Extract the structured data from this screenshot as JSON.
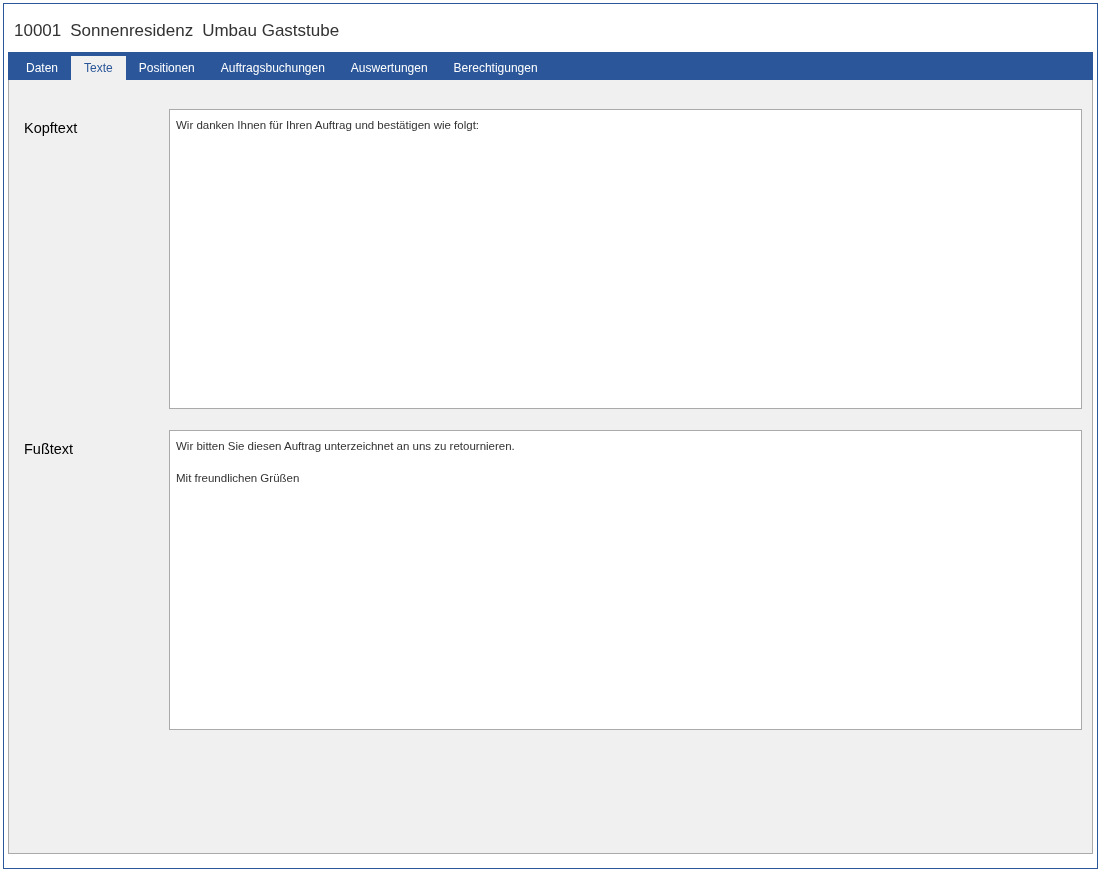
{
  "window": {
    "title_parts": [
      "10001",
      "Sonnenresidenz",
      "Umbau Gaststube"
    ]
  },
  "tabs": [
    {
      "label": "Daten",
      "selected": false
    },
    {
      "label": "Texte",
      "selected": true
    },
    {
      "label": "Positionen",
      "selected": false
    },
    {
      "label": "Auftragsbuchungen",
      "selected": false
    },
    {
      "label": "Auswertungen",
      "selected": false
    },
    {
      "label": "Berechtigungen",
      "selected": false
    }
  ],
  "fields": [
    {
      "label": "Kopftext",
      "value": "Wir danken Ihnen für Ihren Auftrag und bestätigen wie folgt:"
    },
    {
      "label": "Fußtext",
      "value": "Wir bitten Sie diesen Auftrag unterzeichnet an uns zu retournieren.\n\nMit freundlichen Grüßen"
    }
  ]
}
